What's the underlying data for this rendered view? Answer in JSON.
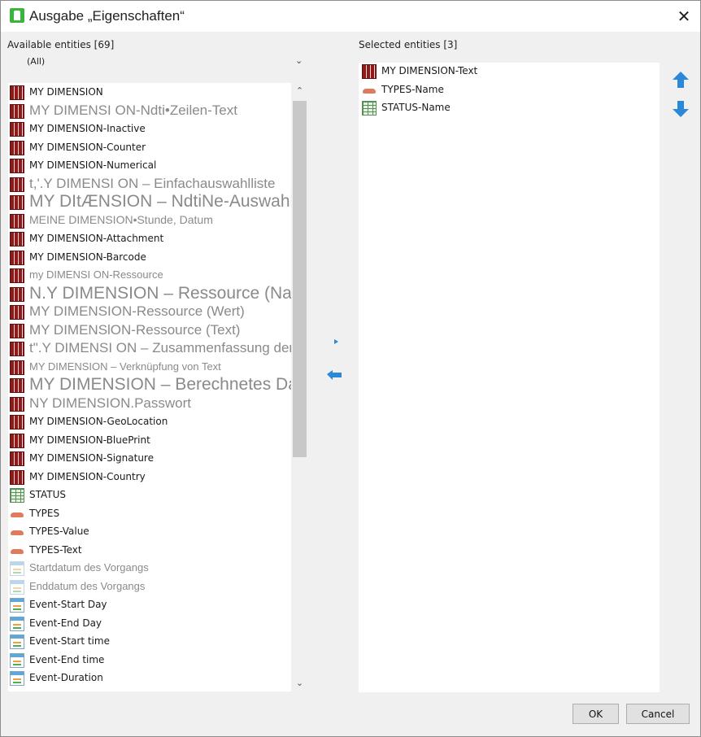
{
  "window": {
    "title": "Ausgabe „Eigenschaften“",
    "close_glyph": "✕"
  },
  "available": {
    "label": "Available entities [69]",
    "filter_value": "(All)",
    "items": [
      {
        "label": "MY DIMENSION",
        "icon": "dimension-icon",
        "style": "normal"
      },
      {
        "label": "MY DIMENSI ON-Ndti•Zeilen-Text",
        "icon": "dimension-icon",
        "style": "mid"
      },
      {
        "label": "MY DIMENSION-Inactive",
        "icon": "dimension-icon",
        "style": "normal"
      },
      {
        "label": "MY DIMENSION-Counter",
        "icon": "dimension-icon",
        "style": "normal"
      },
      {
        "label": "MY DIMENSION-Numerical",
        "icon": "dimension-icon",
        "style": "normal"
      },
      {
        "label": "t,'.Y DIMENSI ON – Einfachauswahlliste",
        "icon": "dimension-icon",
        "style": "mid"
      },
      {
        "label": "MY DItÆNSION – NdtiNe-Auswahlliste",
        "icon": "dimension-icon",
        "style": "big"
      },
      {
        "label": "MEINE DIMENSION•Stunde, Datum",
        "icon": "dimension-icon",
        "style": "gray"
      },
      {
        "label": "MY DIMENSION-Attachment",
        "icon": "dimension-icon",
        "style": "normal"
      },
      {
        "label": "MY DIMENSION-Barcode",
        "icon": "dimension-icon",
        "style": "normal"
      },
      {
        "label": "my DIMENSI ON-Ressource",
        "icon": "dimension-icon",
        "style": "gsm"
      },
      {
        "label": "N.Y DIMENSION – Ressource (Name)",
        "icon": "dimension-icon",
        "style": "big"
      },
      {
        "label": "MY DIMENSION-Ressource (Wert)",
        "icon": "dimension-icon",
        "style": "mid"
      },
      {
        "label": "MY DIMENSlON-Ressource (Text)",
        "icon": "dimension-icon",
        "style": "mid"
      },
      {
        "label": "t\".Y DIMENSI ON – Zusammenfassung der Vorgänge",
        "icon": "dimension-icon",
        "style": "mid"
      },
      {
        "label": "MY DIMENSION – Verknüpfung von Text",
        "icon": "dimension-icon",
        "style": "gsm"
      },
      {
        "label": "MY DIMENSION – Berechnetes Datum",
        "icon": "dimension-icon",
        "style": "big"
      },
      {
        "label": "NY DIMENSION.Passwort",
        "icon": "dimension-icon",
        "style": "mid"
      },
      {
        "label": "MY DIMENSION-GeoLocation",
        "icon": "dimension-icon",
        "style": "normal"
      },
      {
        "label": "MY DIMENSION-BluePrint",
        "icon": "dimension-icon",
        "style": "normal"
      },
      {
        "label": "MY DIMENSION-Signature",
        "icon": "dimension-icon",
        "style": "normal"
      },
      {
        "label": "MY DIMENSION-Country",
        "icon": "dimension-icon",
        "style": "normal"
      },
      {
        "label": "STATUS",
        "icon": "table-icon",
        "style": "normal"
      },
      {
        "label": "TYPES",
        "icon": "types-icon",
        "style": "normal"
      },
      {
        "label": "TYPES-Value",
        "icon": "types-icon",
        "style": "normal"
      },
      {
        "label": "TYPES-Text",
        "icon": "types-icon",
        "style": "normal"
      },
      {
        "label": "Startdatum des Vorgangs",
        "icon": "calendar-icon-faded",
        "style": "gsm"
      },
      {
        "label": "Enddatum des Vorgangs",
        "icon": "calendar-icon-faded",
        "style": "gsm"
      },
      {
        "label": "Event-Start Day",
        "icon": "calendar-icon",
        "style": "normal"
      },
      {
        "label": "Event-End Day",
        "icon": "calendar-icon",
        "style": "normal"
      },
      {
        "label": "Event-Start time",
        "icon": "calendar-icon",
        "style": "normal"
      },
      {
        "label": "Event-End time",
        "icon": "calendar-icon",
        "style": "normal"
      },
      {
        "label": "Event-Duration",
        "icon": "calendar-icon",
        "style": "normal"
      }
    ]
  },
  "selected": {
    "label": "Selected entities [3]",
    "items": [
      {
        "label": "MY DIMENSION-Text",
        "icon": "dimension-icon"
      },
      {
        "label": "TYPES-Name",
        "icon": "types-icon"
      },
      {
        "label": "STATUS-Name",
        "icon": "table-icon"
      }
    ]
  },
  "buttons": {
    "ok": "OK",
    "cancel": "Cancel"
  },
  "colors": {
    "accent_arrow": "#2b88d8",
    "dimension": "#8e1a1a",
    "dialog_bg": "#f0f0f0"
  }
}
